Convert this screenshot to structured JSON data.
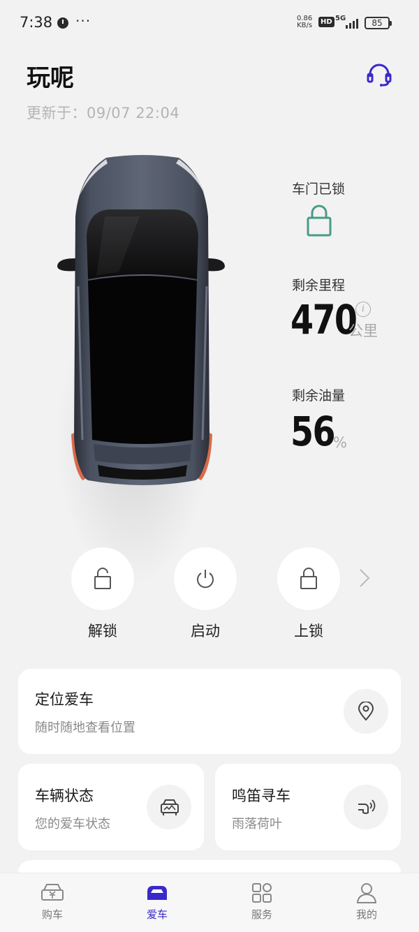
{
  "status_bar": {
    "time": "7:38",
    "more": "···",
    "net_speed_value": "0.86",
    "net_speed_unit": "KB/s",
    "hd": "HD",
    "network": "5G",
    "battery": "85"
  },
  "header": {
    "title": "玩呢",
    "updated": "更新于：09/07 22:04"
  },
  "vehicle": {
    "door_label": "车门已锁",
    "range_label": "剩余里程",
    "range_value": "470",
    "range_unit": "公里",
    "info_mark": "i",
    "fuel_label": "剩余油量",
    "fuel_value": "56",
    "fuel_unit": "%"
  },
  "controls": [
    {
      "label": "解锁",
      "icon": "unlock-icon"
    },
    {
      "label": "启动",
      "icon": "power-icon"
    },
    {
      "label": "上锁",
      "icon": "lock-icon"
    }
  ],
  "cards": {
    "locate": {
      "title": "定位爱车",
      "subtitle": "随时随地查看位置",
      "icon": "location-pin-icon"
    },
    "status": {
      "title": "车辆状态",
      "subtitle": "您的爱车状态",
      "icon": "car-status-icon"
    },
    "honk": {
      "title": "鸣笛寻车",
      "subtitle": "雨落荷叶",
      "icon": "horn-icon"
    }
  },
  "nav": [
    {
      "label": "购车",
      "icon": "buy-car-icon",
      "active": false
    },
    {
      "label": "爱车",
      "icon": "my-car-icon",
      "active": true
    },
    {
      "label": "服务",
      "icon": "services-grid-icon",
      "active": false
    },
    {
      "label": "我的",
      "icon": "profile-icon",
      "active": false
    }
  ],
  "colors": {
    "accent": "#3a29c9",
    "lock_status": "#4a9a88",
    "background": "#f2f2f3"
  }
}
